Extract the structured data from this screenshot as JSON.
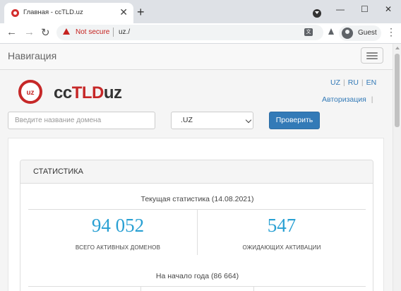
{
  "browser": {
    "tab_title": "Главная - ccTLD.uz",
    "tab_close": "✕",
    "new_tab": "+",
    "window_controls": [
      "—",
      "☐",
      "✕"
    ],
    "back": "←",
    "forward": "→",
    "reload": "↻",
    "security_label": "Not secure",
    "url": "uz./",
    "profile_label": "Guest",
    "menu": "⋮",
    "translate_glyph": "文"
  },
  "navbar": {
    "brand": "Навигация"
  },
  "header": {
    "logo_badge": "uz",
    "logo_text_a": "cc",
    "logo_text_b": "TLD",
    "logo_text_c": "uz",
    "languages": [
      "UZ",
      "RU",
      "EN"
    ],
    "auth_link": "Авторизация",
    "auth_sep": "|"
  },
  "search": {
    "placeholder": "Введите название домена",
    "zone_selected": ".UZ",
    "submit_label": "Проверить"
  },
  "stats": {
    "title": "СТАТИСТИКА",
    "current_label": "Текущая статистика (14.08.2021)",
    "active_domains_value": "94 052",
    "active_domains_label": "ВСЕГО АКТИВНЫХ ДОМЕНОВ",
    "pending_value": "547",
    "pending_label": "ОЖИДАЮЩИХ АКТИВАЦИИ",
    "year_start_label": "На начало года (86 664)"
  },
  "colors": {
    "accent": "#337ab7",
    "stat_number": "#29a0d3",
    "logo_red": "#c62828",
    "warning_red": "#c5221f"
  }
}
